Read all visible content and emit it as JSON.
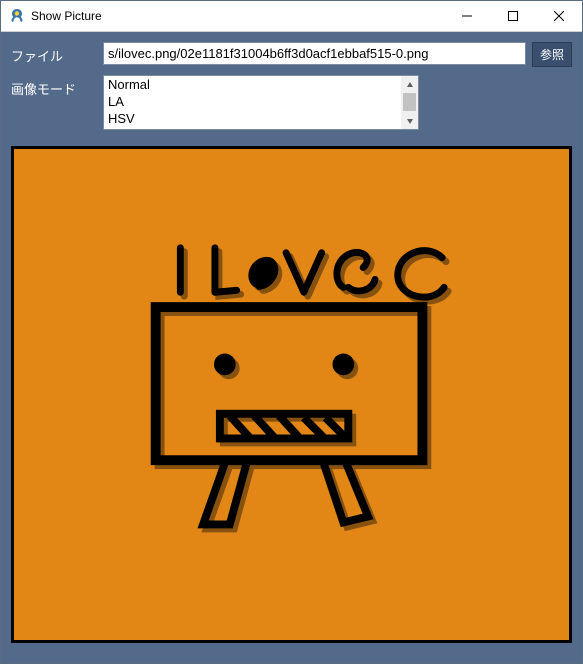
{
  "window": {
    "title": "Show Picture"
  },
  "file": {
    "label": "ファイル",
    "value": "s/ilovec.png/02e1181f31004b6ff3d0acf1ebbaf515-0.png",
    "browse_label": "参照"
  },
  "mode": {
    "label": "画像モード",
    "options": [
      "Normal",
      "LA",
      "HSV"
    ]
  },
  "image": {
    "text": "I love C"
  },
  "colors": {
    "client_bg": "#546a8a",
    "canvas_bg": "#e28716",
    "stroke": "#000000"
  }
}
